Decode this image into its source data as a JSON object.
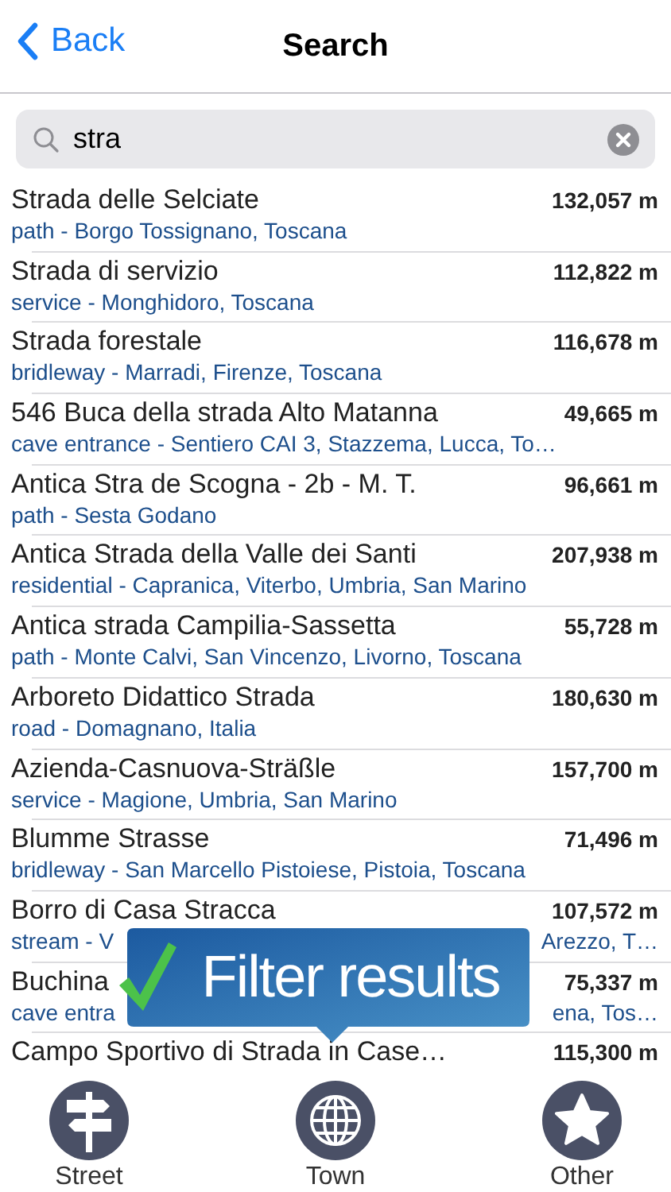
{
  "nav": {
    "back": "Back",
    "title": "Search"
  },
  "search": {
    "value": "stra"
  },
  "results": [
    {
      "title": "Strada delle Selciate",
      "distance": "132,057 m",
      "subtitle": [
        "path - Borgo Tossignano, Toscana"
      ]
    },
    {
      "title": "Strada di servizio",
      "distance": "112,822 m",
      "subtitle": [
        "service - Monghidoro, Toscana"
      ]
    },
    {
      "title": "Strada forestale",
      "distance": "116,678 m",
      "subtitle": [
        "bridleway - Marradi, Firenze, Toscana"
      ]
    },
    {
      "title": "546 Buca della strada Alto Matanna",
      "distance": "49,665 m",
      "subtitle": [
        "cave entrance - Sentiero CAI 3, Stazzema, Lucca, To…"
      ]
    },
    {
      "title": "Antica Stra de Scogna - 2b - M. T.",
      "distance": "96,661 m",
      "subtitle": [
        "path - Sesta Godano"
      ]
    },
    {
      "title": "Antica Strada della Valle dei Santi",
      "distance": "207,938 m",
      "subtitle": [
        "residential - Capranica, Viterbo, Umbria, San Marino"
      ]
    },
    {
      "title": "Antica strada Campilia-Sassetta",
      "distance": "55,728 m",
      "subtitle": [
        "path - Monte Calvi, San Vincenzo, Livorno, Toscana"
      ]
    },
    {
      "title": "Arboreto Didattico Strada",
      "distance": "180,630 m",
      "subtitle": [
        "road - Domagnano, Italia"
      ]
    },
    {
      "title": "Azienda-Casnuova-Sträßle",
      "distance": "157,700 m",
      "subtitle": [
        "service - Magione, Umbria, San Marino"
      ]
    },
    {
      "title": "Blumme Strasse",
      "distance": "71,496 m",
      "subtitle": [
        "bridleway - San Marcello Pistoiese, Pistoia, Toscana"
      ]
    },
    {
      "title": "Borro di Casa Stracca",
      "distance": "107,572 m",
      "subtitle": [
        "stream - V",
        "Arezzo, T…"
      ]
    },
    {
      "title": "Buchina",
      "distance": "75,337 m",
      "subtitle": [
        "cave entra",
        "ena, Tos…"
      ]
    },
    {
      "title": "Campo Sportivo di Strada in Case…",
      "distance": "115,300 m"
    }
  ],
  "callout": {
    "text": "Filter results"
  },
  "tabs": [
    {
      "label": "Street",
      "kind": "signpost"
    },
    {
      "label": "Town",
      "kind": "globe"
    },
    {
      "label": "Other",
      "kind": "star"
    }
  ]
}
